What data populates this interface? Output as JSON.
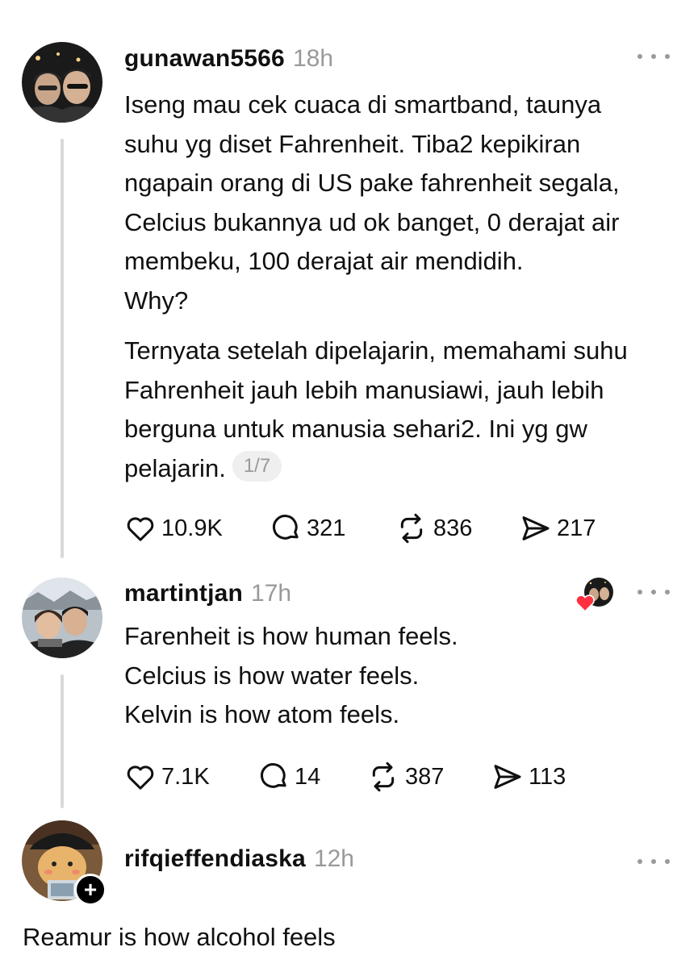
{
  "posts": [
    {
      "username": "gunawan5566",
      "time": "18h",
      "paragraphs": [
        [
          "Iseng mau cek cuaca di smartband, taunya",
          "suhu yg diset Fahrenheit. Tiba2 kepikiran",
          "ngapain orang di US pake fahrenheit segala,",
          "Celcius bukannya ud ok banget, 0 derajat air",
          "membeku, 100 derajat air mendidih.",
          "Why?"
        ],
        [
          "Ternyata setelah dipelajarin, memahami suhu",
          "Fahrenheit jauh lebih manusiawi, jauh lebih",
          "berguna untuk manusia sehari2. Ini yg gw",
          "pelajarin."
        ]
      ],
      "thread_page": "1/7",
      "likes": "10.9K",
      "replies": "321",
      "reposts": "836",
      "shares": "217"
    },
    {
      "username": "martintjan",
      "time": "17h",
      "lines": [
        "Farenheit is how human feels.",
        "Celcius is how water feels.",
        "Kelvin is how atom feels."
      ],
      "likes": "7.1K",
      "replies": "14",
      "reposts": "387",
      "shares": "113"
    },
    {
      "username": "rifqieffendiaska",
      "time": "12h",
      "reply_text": "Reamur is how alcohol feels"
    }
  ],
  "icons": {
    "like": "heart-icon",
    "reply": "comment-icon",
    "repost": "repost-icon",
    "share": "send-icon",
    "more": "more-dots-icon",
    "follow": "plus-icon"
  },
  "colors": {
    "text": "#101010",
    "muted": "#999999",
    "thread_line": "#d9d9d9",
    "heart_badge": "#ff3040"
  }
}
